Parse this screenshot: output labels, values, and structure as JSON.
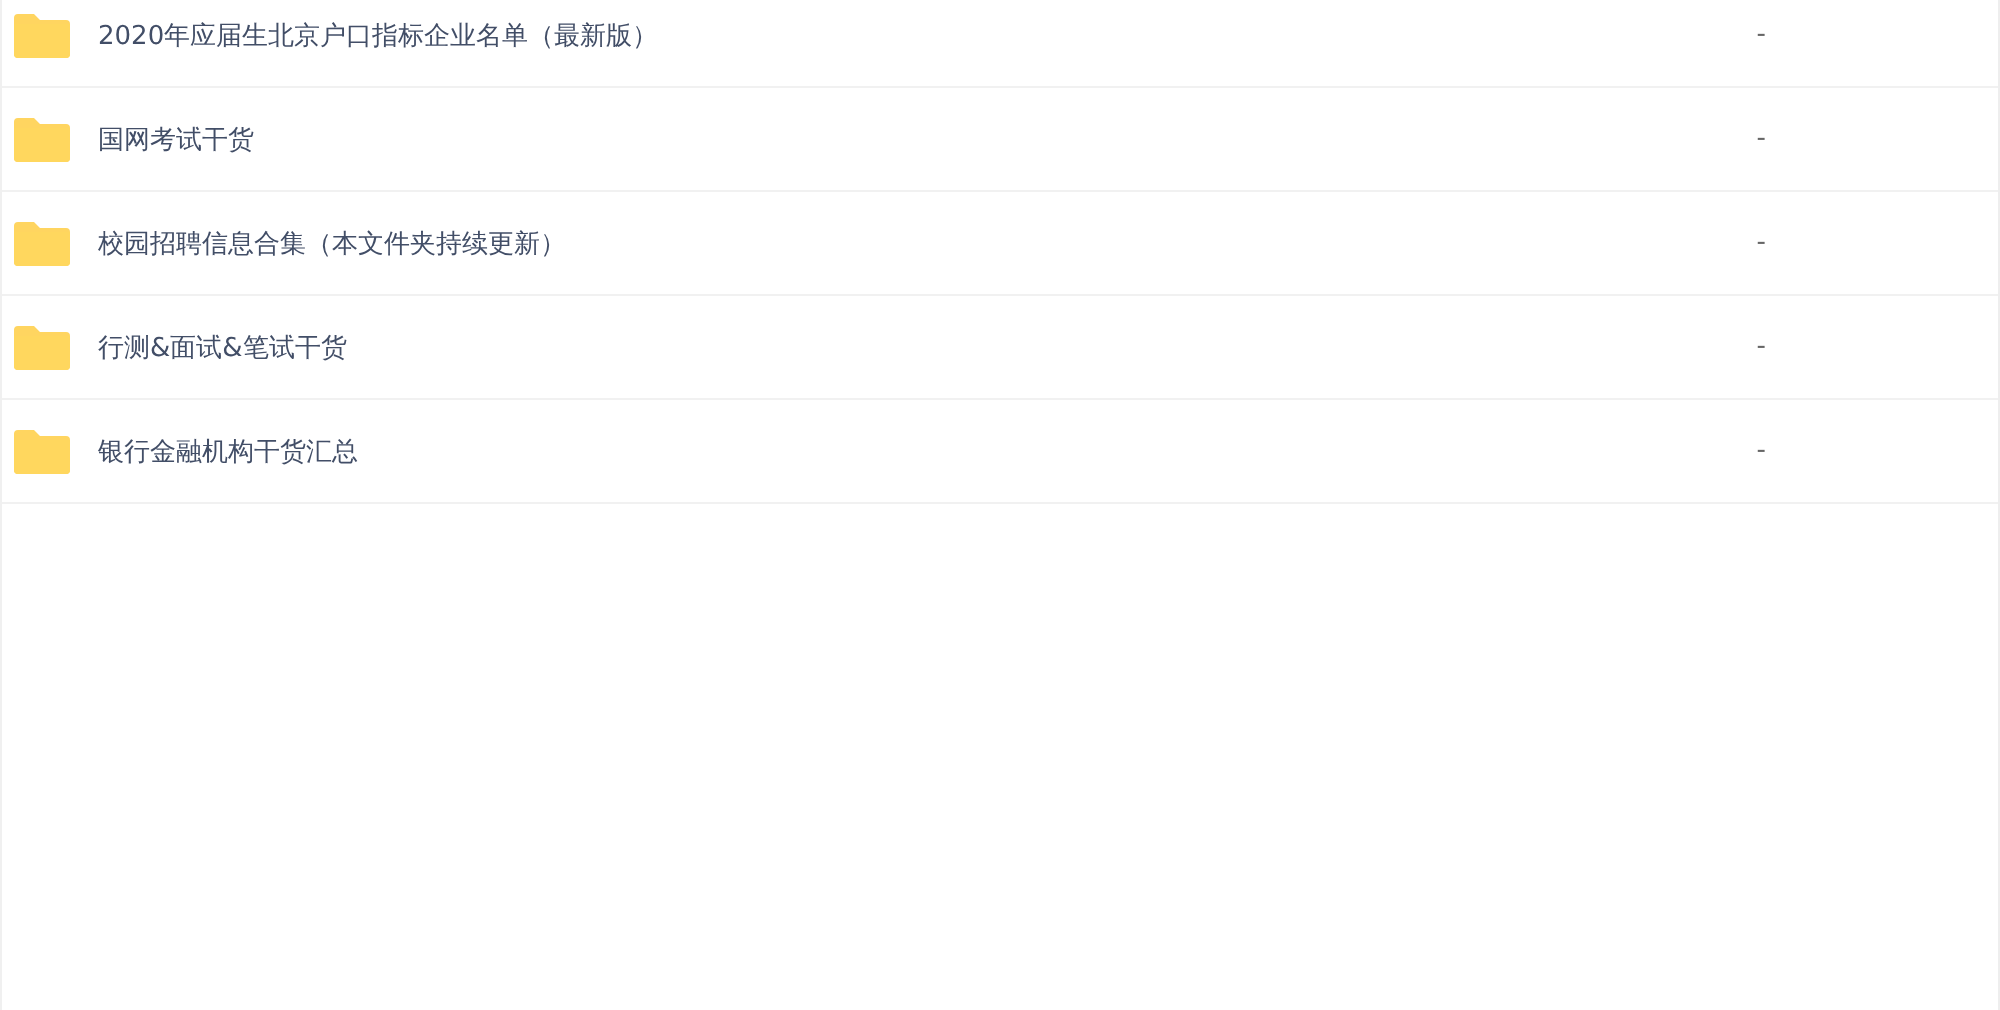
{
  "files": [
    {
      "name": "2020年应届生北京户口指标企业名单（最新版）",
      "size": "-"
    },
    {
      "name": "国网考试干货",
      "size": "-"
    },
    {
      "name": "校园招聘信息合集（本文件夹持续更新）",
      "size": "-"
    },
    {
      "name": "行测&面试&笔试干货",
      "size": "-"
    },
    {
      "name": "银行金融机构干货汇总",
      "size": "-"
    }
  ]
}
